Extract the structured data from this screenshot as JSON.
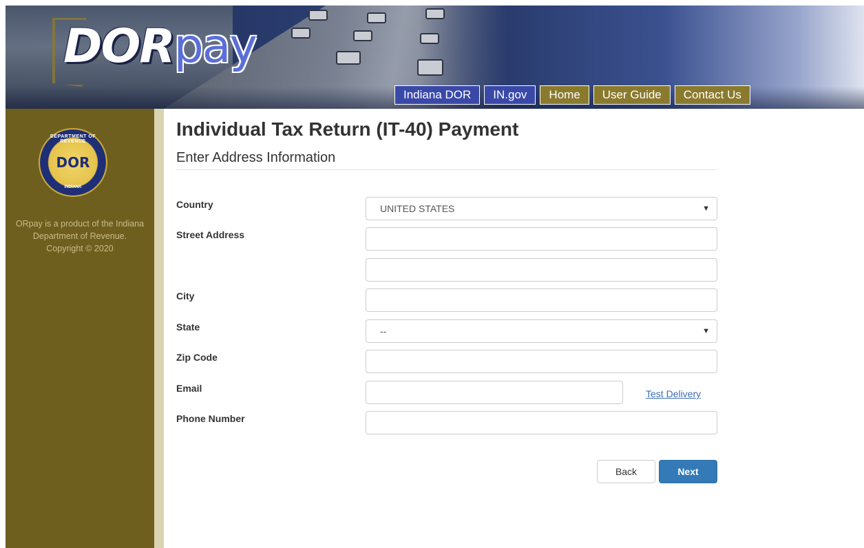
{
  "brand": {
    "logo_dor": "DOR",
    "logo_pay": "pay"
  },
  "nav": [
    {
      "label": "Indiana DOR",
      "style": "blue"
    },
    {
      "label": "IN.gov",
      "style": "blue"
    },
    {
      "label": "Home",
      "style": "gold"
    },
    {
      "label": "User Guide",
      "style": "gold"
    },
    {
      "label": "Contact Us",
      "style": "gold"
    }
  ],
  "sidebar": {
    "seal": {
      "top_text": "DEPARTMENT OF REVENUE",
      "center_text": "DOR",
      "bottom_text": "INDIANA"
    },
    "footer_lines": [
      "ORpay is a product of the Indiana",
      "Department of Revenue.",
      "Copyright © 2020"
    ]
  },
  "main": {
    "title": "Individual Tax Return (IT-40) Payment",
    "subtitle": "Enter Address Information"
  },
  "form": {
    "country": {
      "label": "Country",
      "value": "UNITED STATES"
    },
    "street": {
      "label": "Street Address",
      "value1": "",
      "value2": ""
    },
    "city": {
      "label": "City",
      "value": ""
    },
    "state": {
      "label": "State",
      "value": "--"
    },
    "zip": {
      "label": "Zip Code",
      "value": ""
    },
    "email": {
      "label": "Email",
      "value": ""
    },
    "phone": {
      "label": "Phone Number",
      "value": ""
    },
    "test_delivery": "Test Delivery"
  },
  "buttons": {
    "back": "Back",
    "next": "Next"
  },
  "colors": {
    "sidebar": "#6e5f1e",
    "nav_blue": "#3a49a8",
    "nav_gold": "#8a7a2e",
    "primary_button": "#337ab7",
    "link": "#3b6fb5"
  },
  "icons": {
    "select_arrow": "caret-down-icon"
  }
}
